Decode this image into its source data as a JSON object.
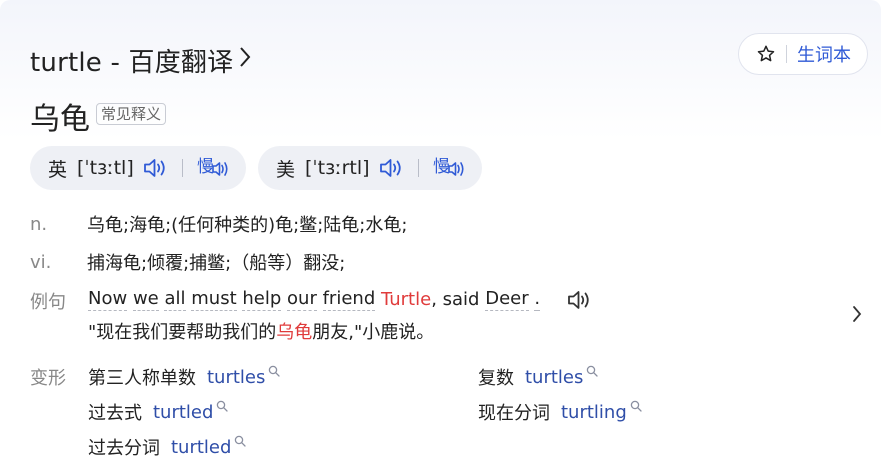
{
  "header": {
    "title": "turtle - 百度翻译",
    "title_chevron_icon": "chevron-right-icon",
    "vocab_button": {
      "icon": "star-outline-icon",
      "label": "生词本"
    }
  },
  "word": {
    "headword": "乌龟",
    "badge": "常见释义"
  },
  "pronunciations": [
    {
      "label": "英",
      "phonetic": "[ˈtɜːtl]",
      "speaker_icon": "speaker-icon",
      "slow_icon": "slow-speaker-icon",
      "slow_label": "慢"
    },
    {
      "label": "美",
      "phonetic": "[ˈtɜːrtl]",
      "speaker_icon": "speaker-icon",
      "slow_icon": "slow-speaker-icon",
      "slow_label": "慢"
    }
  ],
  "definitions": [
    {
      "pos": "n.",
      "text": "乌龟;海龟;(任何种类的)龟;鳖;陆龟;水龟;"
    },
    {
      "pos": "vi.",
      "text": "捕海龟;倾覆;捕鳖;（船等）翻没;"
    }
  ],
  "example": {
    "label": "例句",
    "en_words": [
      "Now",
      "we",
      "all",
      "must",
      "help",
      "our",
      "friend"
    ],
    "en_highlight": "Turtle",
    "en_tail": ", said",
    "en_tail_word": "Deer",
    "en_end": ".",
    "zh_before": "\"现在我们要帮助我们的",
    "zh_highlight": "乌龟",
    "zh_after": "朋友,\"小鹿说。",
    "speaker_icon": "speaker-icon",
    "next_icon": "chevron-right-icon"
  },
  "inflections": {
    "label": "变形",
    "items": [
      {
        "name": "第三人称单数",
        "word": "turtles"
      },
      {
        "name": "复数",
        "word": "turtles"
      },
      {
        "name": "过去式",
        "word": "turtled"
      },
      {
        "name": "现在分词",
        "word": "turtling"
      },
      {
        "name": "过去分词",
        "word": "turtled"
      }
    ],
    "search_icon": "search-icon"
  },
  "colors": {
    "accent_blue": "#2f5ad6",
    "link_blue": "#2f4ea8",
    "highlight_red": "#e03b3b",
    "muted_gray": "#888888",
    "pill_bg": "#eef0f5"
  }
}
